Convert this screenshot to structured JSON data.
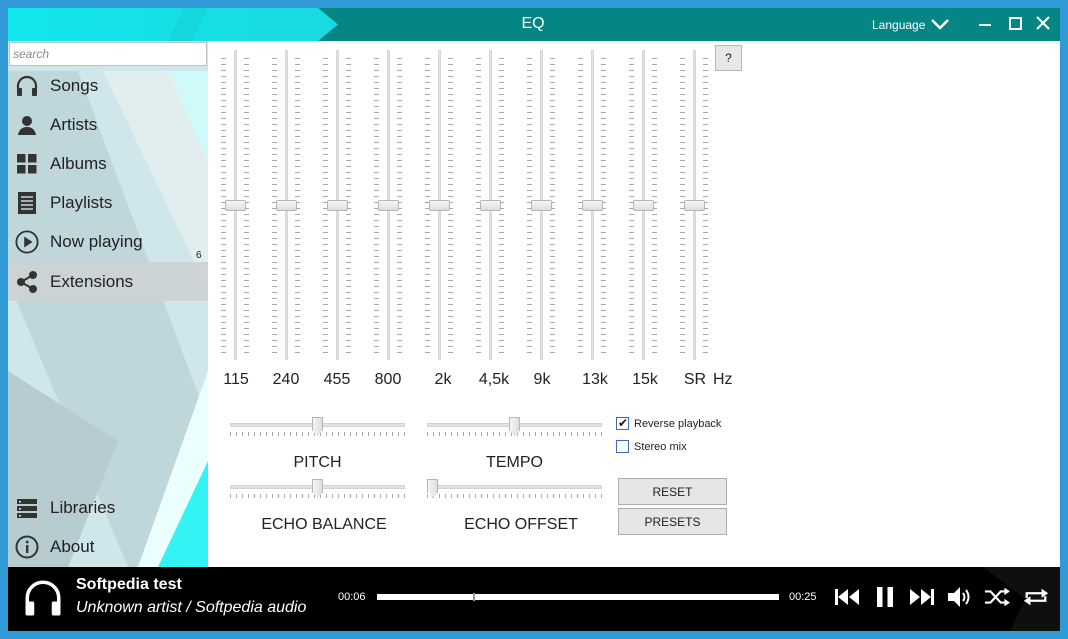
{
  "window": {
    "title": "EQ",
    "language_label": "Language",
    "controls": [
      "minimize",
      "maximize",
      "close"
    ]
  },
  "sidebar": {
    "search_placeholder": "search",
    "items": [
      {
        "label": "Songs",
        "icon": "headphones-icon"
      },
      {
        "label": "Artists",
        "icon": "person-icon"
      },
      {
        "label": "Albums",
        "icon": "grid-icon"
      },
      {
        "label": "Playlists",
        "icon": "list-icon"
      },
      {
        "label": "Now playing",
        "icon": "play-circle-icon"
      },
      {
        "label": "Extensions",
        "icon": "share-icon"
      }
    ],
    "now_playing_count": "6",
    "active_item": "Extensions",
    "bottom_items": [
      {
        "label": "Libraries",
        "icon": "server-icon"
      },
      {
        "label": "About",
        "icon": "info-icon"
      }
    ]
  },
  "eq": {
    "help_label": "?",
    "bands": [
      {
        "label": "115",
        "level": 0.5
      },
      {
        "label": "240",
        "level": 0.5
      },
      {
        "label": "455",
        "level": 0.5
      },
      {
        "label": "800",
        "level": 0.5
      },
      {
        "label": "2k",
        "level": 0.5
      },
      {
        "label": "4,5k",
        "level": 0.5
      },
      {
        "label": "9k",
        "level": 0.5
      },
      {
        "label": "13k",
        "level": 0.5
      },
      {
        "label": "15k",
        "level": 0.5
      },
      {
        "label": "SR",
        "level": 0.5
      }
    ],
    "unit": "Hz",
    "sliders": {
      "pitch": {
        "label": "PITCH",
        "value": 0.5
      },
      "tempo": {
        "label": "TEMPO",
        "value": 0.5
      },
      "echo_balance": {
        "label": "ECHO BALANCE",
        "value": 0.5
      },
      "echo_offset": {
        "label": "ECHO OFFSET",
        "value": 0.0
      }
    },
    "reverse_playback": {
      "label": "Reverse playback",
      "checked": true
    },
    "stereo_mix": {
      "label": "Stereo mix",
      "checked": false
    },
    "reset_label": "RESET",
    "presets_label": "PRESETS"
  },
  "player": {
    "title": "Softpedia test",
    "subtitle": "Unknown artist / Softpedia audio",
    "current_time": "00:06",
    "total_time": "00:25",
    "progress": 0.24
  },
  "colors": {
    "titlebar": "#068585",
    "accent": "#11e6ec",
    "frame": "#2f9ad6"
  }
}
